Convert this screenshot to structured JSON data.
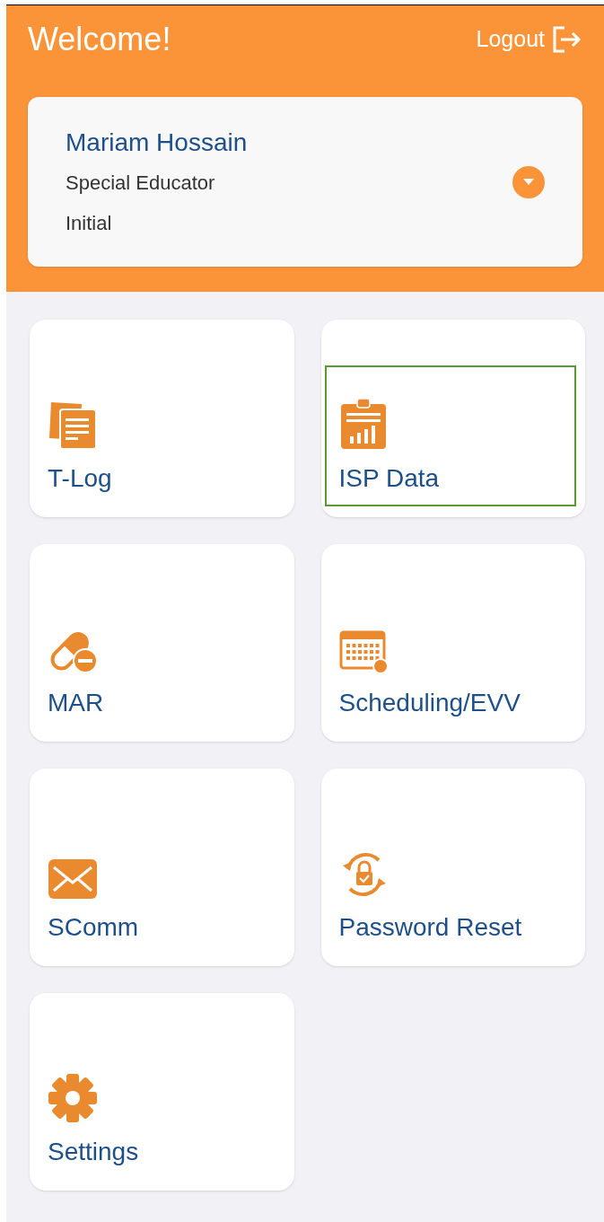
{
  "header": {
    "title": "Welcome!",
    "logout": "Logout"
  },
  "profile": {
    "name": "Mariam Hossain",
    "role": "Special Educator",
    "status": "Initial"
  },
  "tiles": [
    {
      "label": "T-Log",
      "kind": "notes",
      "selected": false
    },
    {
      "label": "ISP Data",
      "kind": "clipboard",
      "selected": true
    },
    {
      "label": "MAR",
      "kind": "pill",
      "selected": false
    },
    {
      "label": "Scheduling/EVV",
      "kind": "calendar",
      "selected": false
    },
    {
      "label": "SComm",
      "kind": "mail",
      "selected": false
    },
    {
      "label": "Password Reset",
      "kind": "lock",
      "selected": false
    },
    {
      "label": "Settings",
      "kind": "gear",
      "selected": false
    }
  ]
}
